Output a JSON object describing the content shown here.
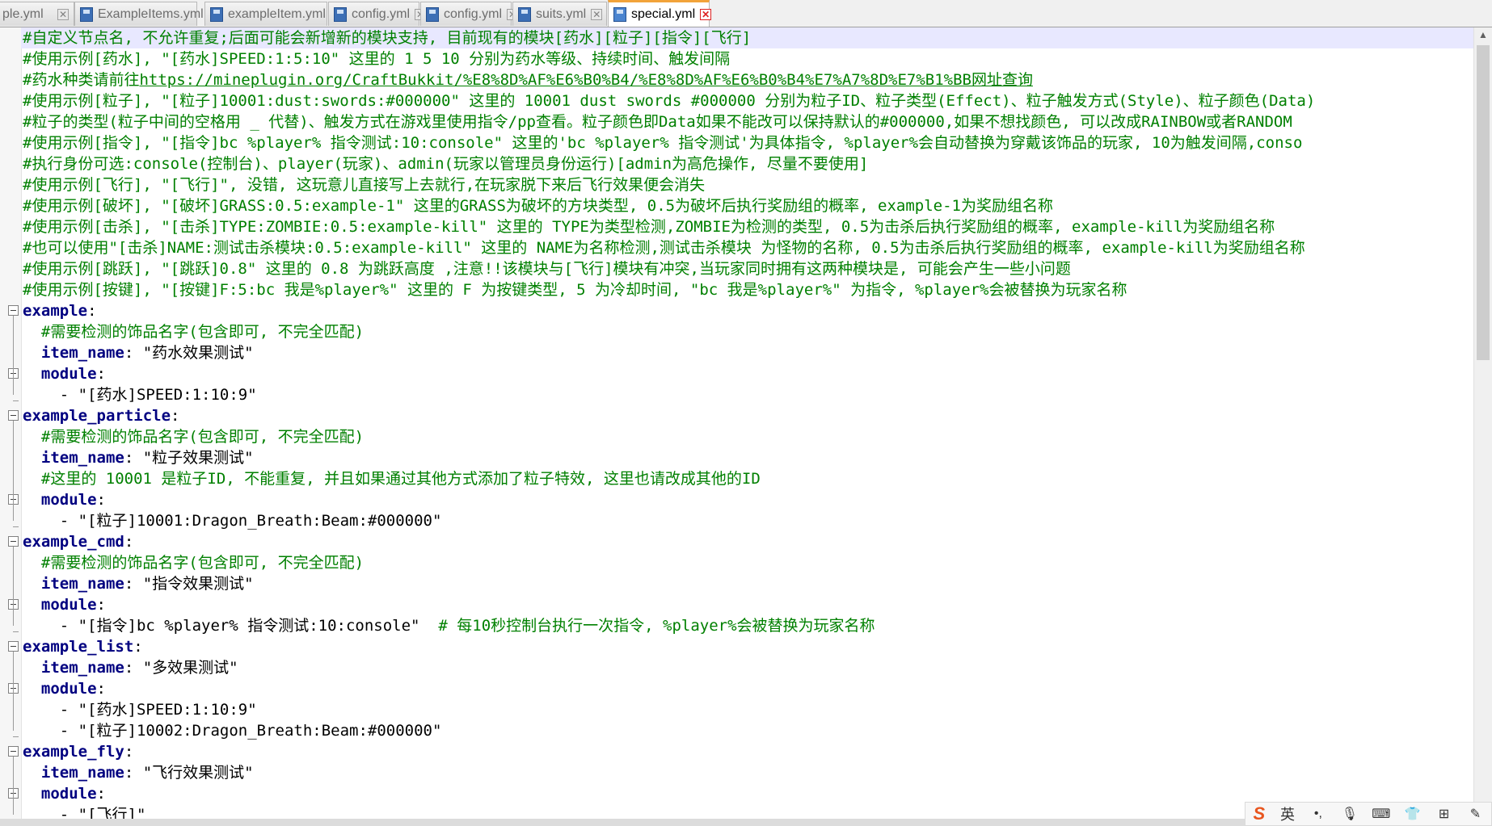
{
  "tabs": [
    {
      "label": "ple.yml"
    },
    {
      "label": "ExampleItems.yml"
    },
    {
      "label": "exampleItem.yml"
    },
    {
      "label": "config.yml"
    },
    {
      "label": "config.yml"
    },
    {
      "label": "suits.yml"
    },
    {
      "label": "special.yml"
    }
  ],
  "active_tab": "special.yml",
  "close_glyph": "✕",
  "lines": [
    {
      "type": "comment",
      "text": "#自定义节点名, 不允许重复;后面可能会新增新的模块支持, 目前现有的模块[药水][粒子][指令][飞行]"
    },
    {
      "type": "comment",
      "text": "#使用示例[药水], \"[药水]SPEED:1:5:10\" 这里的 1 5 10 分别为药水等级、持续时间、触发间隔"
    },
    {
      "type": "comment_url",
      "text": "#药水种类请前往",
      "url": "https://mineplugin.org/CraftBukkit/%E8%8D%AF%E6%B0%B4/%E8%8D%AF%E6%B0%B4%E7%A7%8D%E7%B1%BB网址查询"
    },
    {
      "type": "comment",
      "text": "#使用示例[粒子], \"[粒子]10001:dust:swords:#000000\" 这里的 10001 dust swords #000000 分别为粒子ID、粒子类型(Effect)、粒子触发方式(Style)、粒子颜色(Data)"
    },
    {
      "type": "comment",
      "text": "#粒子的类型(粒子中间的空格用 _ 代替)、触发方式在游戏里使用指令/pp查看。粒子颜色即Data如果不能改可以保持默认的#000000,如果不想找颜色, 可以改成RAINBOW或者RANDOM"
    },
    {
      "type": "comment",
      "text": "#使用示例[指令], \"[指令]bc %player% 指令测试:10:console\" 这里的'bc %player% 指令测试'为具体指令, %player%会自动替换为穿戴该饰品的玩家, 10为触发间隔,conso"
    },
    {
      "type": "comment",
      "text": "#执行身份可选:console(控制台)、player(玩家)、admin(玩家以管理员身份运行)[admin为高危操作, 尽量不要使用]"
    },
    {
      "type": "comment",
      "text": "#使用示例[飞行], \"[飞行]\", 没错, 这玩意儿直接写上去就行,在玩家脱下来后飞行效果便会消失"
    },
    {
      "type": "comment",
      "text": "#使用示例[破坏], \"[破坏]GRASS:0.5:example-1\" 这里的GRASS为破坏的方块类型, 0.5为破坏后执行奖励组的概率, example-1为奖励组名称"
    },
    {
      "type": "comment",
      "text": "#使用示例[击杀], \"[击杀]TYPE:ZOMBIE:0.5:example-kill\" 这里的 TYPE为类型检测,ZOMBIE为检测的类型, 0.5为击杀后执行奖励组的概率, example-kill为奖励组名称"
    },
    {
      "type": "comment",
      "text": "#也可以使用\"[击杀]NAME:测试击杀模块:0.5:example-kill\" 这里的 NAME为名称检测,测试击杀模块 为怪物的名称, 0.5为击杀后执行奖励组的概率, example-kill为奖励组名称"
    },
    {
      "type": "comment",
      "text": "#使用示例[跳跃], \"[跳跃]0.8\" 这里的 0.8 为跳跃高度 ,注意!!该模块与[飞行]模块有冲突,当玩家同时拥有这两种模块是, 可能会产生一些小问题"
    },
    {
      "type": "comment",
      "text": "#使用示例[按键], \"[按键]F:5:bc 我是%player%\" 这里的 F 为按键类型, 5 为冷却时间, \"bc 我是%player%\" 为指令, %player%会被替换为玩家名称"
    },
    {
      "type": "key",
      "indent": "",
      "key": "example",
      "rest": ":"
    },
    {
      "type": "comment",
      "indent": "  ",
      "text": "#需要检测的饰品名字(包含即可, 不完全匹配)"
    },
    {
      "type": "key",
      "indent": "  ",
      "key": "item_name",
      "rest": ": \"药水效果测试\""
    },
    {
      "type": "key",
      "indent": "  ",
      "key": "module",
      "rest": ":"
    },
    {
      "type": "plain",
      "text": "    - \"[药水]SPEED:1:10:9\""
    },
    {
      "type": "key",
      "indent": "",
      "key": "example_particle",
      "rest": ":"
    },
    {
      "type": "comment",
      "indent": "  ",
      "text": "#需要检测的饰品名字(包含即可, 不完全匹配)"
    },
    {
      "type": "key",
      "indent": "  ",
      "key": "item_name",
      "rest": ": \"粒子效果测试\""
    },
    {
      "type": "comment",
      "indent": "  ",
      "text": "#这里的 10001 是粒子ID, 不能重复, 并且如果通过其他方式添加了粒子特效, 这里也请改成其他的ID"
    },
    {
      "type": "key",
      "indent": "  ",
      "key": "module",
      "rest": ":"
    },
    {
      "type": "plain",
      "text": "    - \"[粒子]10001:Dragon_Breath:Beam:#000000\""
    },
    {
      "type": "key",
      "indent": "",
      "key": "example_cmd",
      "rest": ":"
    },
    {
      "type": "comment",
      "indent": "  ",
      "text": "#需要检测的饰品名字(包含即可, 不完全匹配)"
    },
    {
      "type": "key",
      "indent": "  ",
      "key": "item_name",
      "rest": ": \"指令效果测试\""
    },
    {
      "type": "key",
      "indent": "  ",
      "key": "module",
      "rest": ":"
    },
    {
      "type": "plain_comment",
      "text": "    - \"[指令]bc %player% 指令测试:10:console\"  ",
      "comment": "# 每10秒控制台执行一次指令, %player%会被替换为玩家名称"
    },
    {
      "type": "key",
      "indent": "",
      "key": "example_list",
      "rest": ":"
    },
    {
      "type": "key",
      "indent": "  ",
      "key": "item_name",
      "rest": ": \"多效果测试\""
    },
    {
      "type": "key",
      "indent": "  ",
      "key": "module",
      "rest": ":"
    },
    {
      "type": "plain",
      "text": "    - \"[药水]SPEED:1:10:9\""
    },
    {
      "type": "plain",
      "text": "    - \"[粒子]10002:Dragon_Breath:Beam:#000000\""
    },
    {
      "type": "key",
      "indent": "",
      "key": "example_fly",
      "rest": ":"
    },
    {
      "type": "key",
      "indent": "  ",
      "key": "item_name",
      "rest": ": \"飞行效果测试\""
    },
    {
      "type": "key",
      "indent": "  ",
      "key": "module",
      "rest": ":"
    },
    {
      "type": "plain",
      "text": "    - \"[飞行]\""
    }
  ],
  "ime": {
    "logo": "S",
    "lang": "英",
    "icons": [
      "punctuation-icon",
      "microphone-icon",
      "keyboard-icon",
      "skin-icon",
      "grid-icon",
      "tools-icon"
    ],
    "glyphs": [
      "•,",
      "🎙",
      "⌨",
      "👕",
      "⊞",
      "✎"
    ]
  },
  "colors": {
    "comment": "#008000",
    "key": "#000080",
    "active_tab_accent": "#f2a33a",
    "current_line": "#e8e8ff"
  }
}
